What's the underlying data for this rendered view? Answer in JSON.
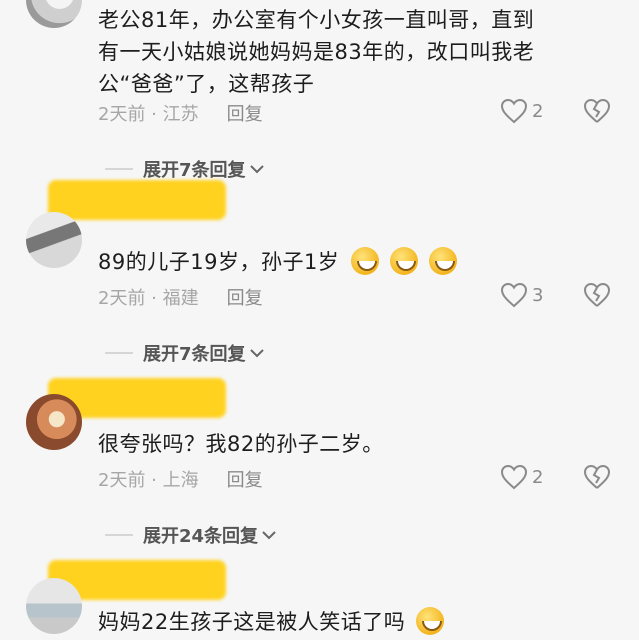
{
  "comments": [
    {
      "text_line1": "老公81年，办公室有个小女孩一直叫哥，直到",
      "text_line2": "有一天小姑娘说她妈妈是83年的，改口叫我老",
      "text_line3": "公“爸爸”了，这帮孩子",
      "meta": "2天前 · 江苏",
      "reply": "回复",
      "likes": "2",
      "expand": "展开7条回复"
    },
    {
      "text": "89的儿子19岁，孙子1岁",
      "meta": "2天前 · 福建",
      "reply": "回复",
      "likes": "3",
      "expand": "展开7条回复"
    },
    {
      "text": "很夸张吗？我82的孙子二岁。",
      "meta": "2天前 · 上海",
      "reply": "回复",
      "likes": "2",
      "expand": "展开24条回复"
    },
    {
      "text": "妈妈22生孩子这是被人笑话了吗"
    }
  ],
  "icons": {
    "like": "heart-icon",
    "dislike": "broken-heart-icon",
    "expand": "chevron-down-icon",
    "emoji": "laughing-face-icon"
  },
  "colors": {
    "background": "#f6f6f6",
    "name_highlight": "#ffd21f",
    "meta_text": "#a6a6a6",
    "body_text": "#1d1d1d"
  }
}
